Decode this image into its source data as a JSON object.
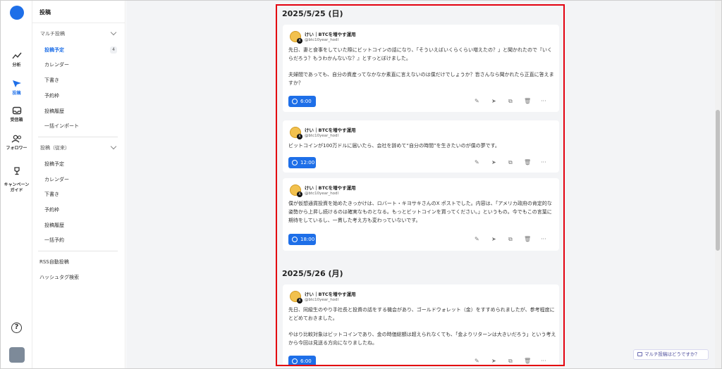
{
  "rail": {
    "items": [
      {
        "label": "分析",
        "icon": "chart-icon"
      },
      {
        "label": "投稿",
        "icon": "send-icon",
        "active": true
      },
      {
        "label": "受信箱",
        "icon": "inbox-icon"
      },
      {
        "label": "フォロワー",
        "icon": "users-icon"
      },
      {
        "label": "キャンペーン\nガイド",
        "icon": "trophy-icon"
      }
    ],
    "help": "?"
  },
  "menu": {
    "title": "投稿",
    "section1": {
      "label": "マルチ投稿",
      "items": [
        "投稿予定",
        "カレンダー",
        "下書き",
        "予約枠",
        "投稿履歴",
        "一括インポート"
      ],
      "badge": "4"
    },
    "section2": {
      "label": "投稿（従来）",
      "items": [
        "投稿予定",
        "カレンダー",
        "下書き",
        "予約枠",
        "投稿履歴",
        "一括予約"
      ]
    },
    "extra": [
      "RSS自動投稿",
      "ハッシュタグ検索"
    ]
  },
  "account": {
    "name": "けい｜BTCを増やす運用",
    "handle": "@btc10year_hodl"
  },
  "days": [
    {
      "date": "2025/5/25 (日)",
      "posts": [
        {
          "paragraphs": [
            "先日、妻と食事をしていた際にビットコインの話になり、「そういえばいくらくらい増えたの？」と聞かれたので『いくらだろう？もうわかんないな？』とすっとぼけました。",
            "夫婦間であっても、自分の資産ってなかなか素直に言えないのは僕だけでしょうか？皆さんなら聞かれたら正直に答えますか？"
          ],
          "time": "6:00"
        },
        {
          "paragraphs": [
            "ビットコインが100万ドルに届いたら、会社を辞めて“自分の時間”を生きたいのが僕の夢です。"
          ],
          "time": "12:00"
        },
        {
          "paragraphs": [
            "僕が仮想通貨投資を始めたきっかけは、ロバート・キヨサキさんのX ポストでした。内容は、「アメリカ政府の肯定的な姿勢から上昇し続けるのは確実なものとなる。もっとビットコインを買ってください。」というもの。今でもこの言葉に期待をしているし、一貫した考え方も変わっていないです。"
          ],
          "time": "18:00"
        }
      ]
    },
    {
      "date": "2025/5/26 (月)",
      "posts": [
        {
          "paragraphs": [
            "先日、同級生のやり手社長と投資の話をする機会があり、ゴールドウォレット（金）をすすめられましたが、参考程度にとどめておきました。",
            "やはり比較対象はビットコインであり、金の時価総額は超えられなくても、「金よりリターンは大きいだろう」という考えから今回は見送る方向になりましたね。"
          ],
          "time": "6:00"
        }
      ]
    }
  ],
  "chat_button": "マルチ投稿はどうですか？",
  "colors": {
    "accent": "#1e6fe8",
    "highlight": "#e3000f"
  }
}
